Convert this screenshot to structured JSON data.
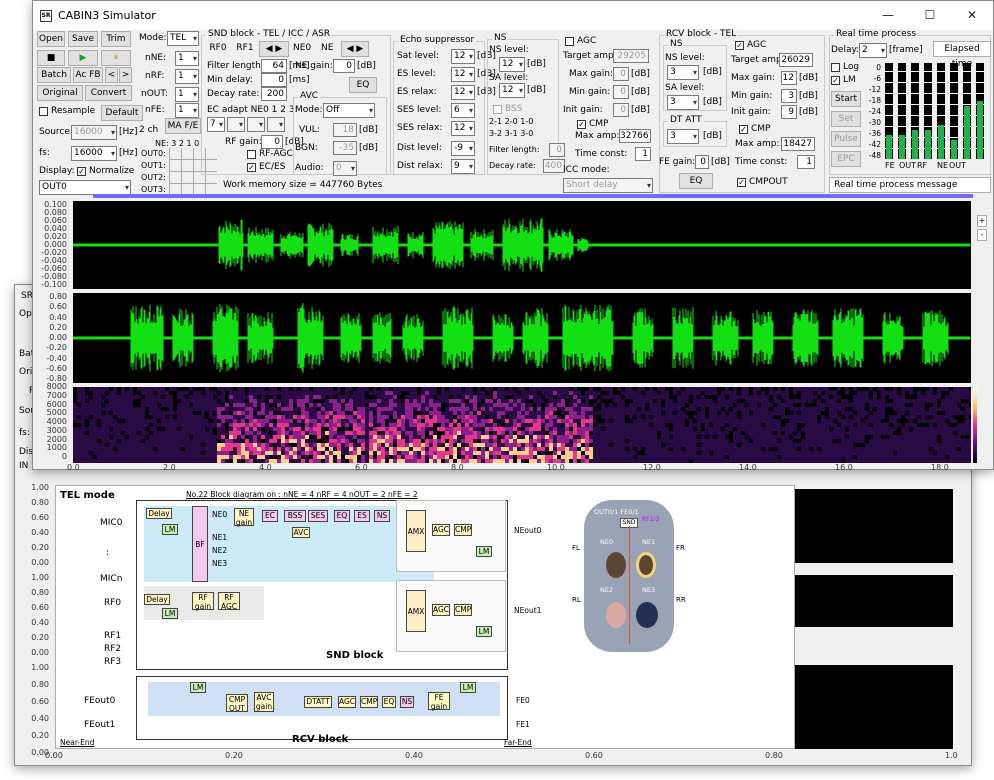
{
  "app": {
    "title": "CABIN3 Simulator",
    "icon": "SR"
  },
  "toolbar": {
    "open": "Open",
    "save": "Save",
    "trim": "Trim",
    "stop": "■",
    "play": "▶",
    "pause": "⏸",
    "batch": "Batch",
    "acfb": "Ac FB",
    "prev": "<",
    "next": ">",
    "original": "Original",
    "convert": "Convert",
    "resample": "Resample",
    "default": "Default",
    "source": "Source:",
    "fs": "fs:",
    "src_rate": "16000",
    "fs_rate": "16000",
    "hz": "[Hz]",
    "ch": "2 ch",
    "display": "Display:",
    "normalize": "Normalize",
    "out_sel": "OUT0"
  },
  "mode": {
    "label": "Mode:",
    "value": "TEL",
    "nne": "nNE:",
    "nrf": "nRF:",
    "nout": "nOUT:",
    "nfe": "nFE:",
    "nne_v": "1",
    "nrf_v": "1",
    "nout_v": "1",
    "nfe_v": "1",
    "mafe": "MA F/E",
    "ne_row": "NE: 3  2  1  0",
    "out0": "OUT0:",
    "out1": "OUT1:",
    "out2": "OUT2:",
    "out3": "OUT3:"
  },
  "snd": {
    "title": "SND block - TEL / ICC / ASR",
    "rf0": "RF0",
    "rf1": "RF1",
    "ne0": "NE0",
    "ne1": "NE",
    "filter_length": "Filter length:",
    "filter_length_v": "64",
    "ms": "[ms]",
    "min_delay": "Min delay:",
    "min_delay_v": "0",
    "decay": "Decay rate:",
    "decay_v": "200",
    "ec_adapt": "EC adapt NE0 1 2 3:",
    "ec_v": "7",
    "rf_gain": "RF gain:",
    "rf_gain_v": "0",
    "db": "[dB]",
    "rf_agc": "RF-AGC",
    "ec_es": "EC/ES",
    "ne_gain": "NE gain:",
    "ne_gain_v": "0",
    "eq": "EQ",
    "avc": "AVC",
    "avc_mode": "Mode:",
    "avc_mode_v": "Off",
    "vul": "VUL:",
    "vul_v": "18",
    "bgn": "BGN:",
    "bgn_v": "-35",
    "audio": "Audio:",
    "audio_v": "0"
  },
  "echo": {
    "title": "Echo suppressor",
    "sat": "Sat level:",
    "sat_v": "12",
    "es": "ES level:",
    "es_v": "12",
    "esr": "ES relax:",
    "esr_v": "12",
    "ses": "SES level:",
    "ses_v": "6",
    "sesr": "SES relax:",
    "sesr_v": "12",
    "dist": "Dist level:",
    "dist_v": "-9",
    "distr": "Dist relax:",
    "distr_v": "9"
  },
  "ns": {
    "title": "NS",
    "nsl": "NS level:",
    "nsl_v": "12",
    "sal": "SA level:",
    "sal_v": "12",
    "bss": "BSS",
    "bss1": "2-1 2-0 1-0",
    "bss2": "3-2 3-1 3-0",
    "filter": "Filter length:",
    "filter_v": "0",
    "decay": "Decay rate:",
    "decay_v": "400"
  },
  "agc": {
    "title": "AGC",
    "target": "Target amp:",
    "target_v": "29205",
    "maxg": "Max gain:",
    "maxg_v": "0",
    "ming": "Min gain:",
    "ming_v": "0",
    "initg": "Init gain:",
    "initg_v": "0",
    "cmp": "CMP",
    "cmp_max": "Max amp:",
    "cmp_max_v": "32766",
    "tconst": "Time const:",
    "tconst_v": "1",
    "icc": "ICC mode:",
    "icc_v": "Short delay"
  },
  "rcv": {
    "title": "RCV block - TEL",
    "ns": "NS",
    "nsl": "NS level:",
    "nsl_v": "3",
    "sal": "SA level:",
    "sal_v": "3",
    "dtatt": "DT ATT",
    "dtatt_v": "3",
    "fe_gain": "FE gain:",
    "fe_gain_v": "0",
    "eq": "EQ",
    "agc": "AGC",
    "target": "Target amp:",
    "target_v": "26029",
    "maxg": "Max gain:",
    "maxg_v": "12",
    "ming": "Min gain:",
    "ming_v": "3",
    "initg": "Init gain:",
    "initg_v": "9",
    "cmp": "CMP",
    "cmp_max": "Max amp:",
    "cmp_max_v": "18427",
    "tconst": "Time const:",
    "tconst_v": "1",
    "cmpout": "CMPOUT"
  },
  "rt": {
    "title": "Real time process",
    "delay": "Delay:",
    "delay_v": "2",
    "frame": "[frame]",
    "elapsed": "Elapsed time",
    "log": "Log",
    "lm": "LM",
    "start": "Start",
    "set": "Set",
    "pulse": "Pulse",
    "epc": "EPC",
    "meter_labels": [
      "FE",
      "OUT",
      "RF",
      "NE",
      "OUT"
    ],
    "scale": [
      "0",
      "-6",
      "-12",
      "-18",
      "-24",
      "-30",
      "-36",
      "-42",
      "-48"
    ],
    "levels": [
      0.25,
      0.25,
      0.3,
      0.3,
      0.35,
      0.2,
      0.55,
      0.6
    ],
    "message": "Real time process message"
  },
  "status": {
    "memory": "Work memory size = 447760 Bytes"
  },
  "plots": {
    "y1": [
      "0.100",
      "0.080",
      "0.060",
      "0.040",
      "0.020",
      "0.000",
      "-0.020",
      "-0.040",
      "-0.060",
      "-0.080",
      "-0.100"
    ],
    "y2": [
      "0.80",
      "0.60",
      "0.40",
      "0.20",
      "0.00",
      "-0.20",
      "-0.40",
      "-0.60",
      "-0.80"
    ],
    "y3": [
      "8000",
      "7000",
      "6000",
      "5000",
      "4000",
      "3000",
      "2000",
      "1000",
      "0"
    ],
    "x": [
      "0.0",
      "2.0",
      "4.0",
      "6.0",
      "8.0",
      "10.0",
      "12.0",
      "14.0",
      "16.0",
      "18.0"
    ]
  },
  "back": {
    "ylabels": [
      "1.00",
      "0.80",
      "0.60",
      "0.40",
      "0.20",
      "0.00",
      "1.00",
      "0.80",
      "0.60",
      "0.40",
      "0.20",
      "0.00",
      "1.00",
      "0.80",
      "0.60",
      "0.40",
      "0.20",
      "0.00"
    ],
    "x": [
      "0.00",
      "0.20",
      "0.40",
      "0.60",
      "0.80",
      "1.0"
    ],
    "side": [
      "Ope",
      "Batc",
      "Ori",
      "R",
      "Sour",
      "fs:",
      "Disp",
      "IN S"
    ]
  },
  "diagram": {
    "title": "TEL mode",
    "info": "No.22    Block diagram on :   nNE = 4   nRF = 4   nOUT = 2  nFE = 2",
    "snd": "SND block",
    "rcv": "RCV block",
    "near": "Near-End",
    "far": "Far-End",
    "mic0": "MIC0",
    "mic_dots": ":",
    "micn": "MICn",
    "rf0": "RF0",
    "rf1": "RF1",
    "rf2": "RF2",
    "rf3": "RF3",
    "feout0": "FEout0",
    "feout1": "FEout1",
    "neout0": "NEout0",
    "neout1": "NEout1",
    "fe0": "FE0",
    "fe1": "FE1",
    "ne0": "NE0",
    "ne1": "NE1",
    "ne2": "NE2",
    "ne3": "NE3",
    "delay": "Delay",
    "lm": "LM",
    "bf": "BF",
    "negain": "NE gain",
    "ec": "EC",
    "bss": "BSS",
    "ses": "SES",
    "eq": "EQ",
    "es": "ES",
    "ns": "NS",
    "avc": "AVC",
    "amx": "AMX",
    "agc": "AGC",
    "cmp": "CMP",
    "rfgain": "RF gain",
    "rfagc": "RF AGC",
    "cmpout": "CMP OUT",
    "avcgain": "AVC gain",
    "dtatt": "DTATT",
    "fegain": "FE gain",
    "car_top": "OUT0/1 FE0/1",
    "car_mid": "SND",
    "car_mid2": "RF2/3",
    "fl": "FL",
    "fr": "FR",
    "rl": "RL",
    "rr": "RR",
    "ne0s": "NE0",
    "ne1s": "NE1",
    "ne2s": "NE2",
    "ne3s": "NE3"
  }
}
